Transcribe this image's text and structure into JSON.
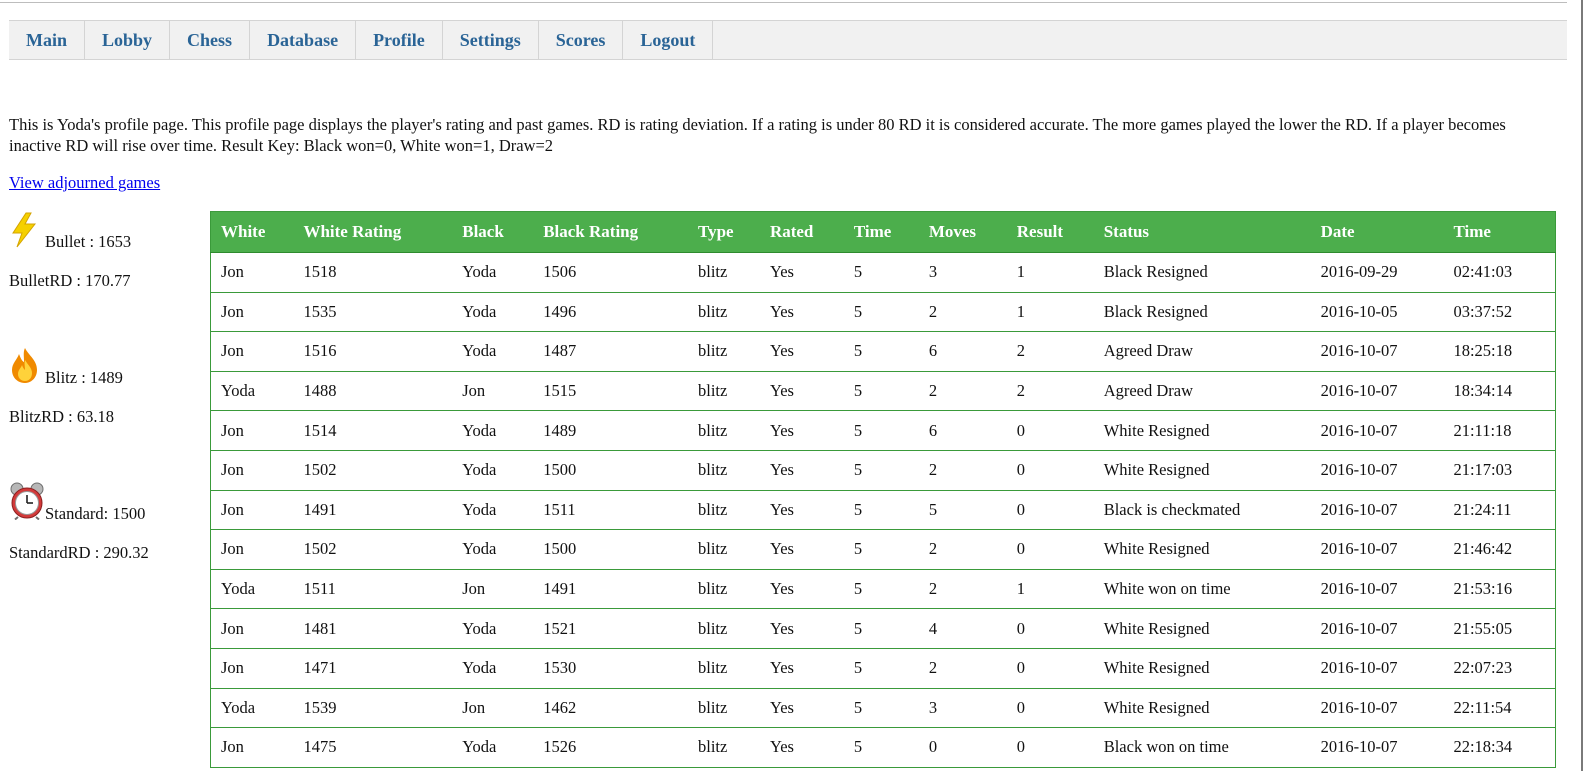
{
  "nav": {
    "items": [
      "Main",
      "Lobby",
      "Chess",
      "Database",
      "Profile",
      "Settings",
      "Scores",
      "Logout"
    ]
  },
  "intro": {
    "text": "This is Yoda's profile page. This profile page displays the player's rating and past games. RD is rating deviation. If a rating is under 80 RD it is considered accurate. The more games played the lower the RD. If a player becomes inactive RD will rise over time. Result Key: Black won=0, White won=1, Draw=2"
  },
  "adjourned_link": "View adjourned games",
  "ratings": {
    "bullet": {
      "label": "Bullet : 1653",
      "rd": "BulletRD : 170.77",
      "icon": "lightning-icon"
    },
    "blitz": {
      "label": "Blitz : 1489",
      "rd": "BlitzRD : 63.18",
      "icon": "fire-icon"
    },
    "standard": {
      "label": "Standard: 1500",
      "rd": "StandardRD : 290.32",
      "icon": "alarm-clock-icon"
    }
  },
  "table": {
    "headers": [
      "White",
      "White Rating",
      "Black",
      "Black Rating",
      "Type",
      "Rated",
      "Time",
      "Moves",
      "Result",
      "Status",
      "Date",
      "Time"
    ],
    "rows": [
      [
        "Jon",
        "1518",
        "Yoda",
        "1506",
        "blitz",
        "Yes",
        "5",
        "3",
        "1",
        "Black Resigned",
        "2016-09-29",
        "02:41:03"
      ],
      [
        "Jon",
        "1535",
        "Yoda",
        "1496",
        "blitz",
        "Yes",
        "5",
        "2",
        "1",
        "Black Resigned",
        "2016-10-05",
        "03:37:52"
      ],
      [
        "Jon",
        "1516",
        "Yoda",
        "1487",
        "blitz",
        "Yes",
        "5",
        "6",
        "2",
        "Agreed Draw",
        "2016-10-07",
        "18:25:18"
      ],
      [
        "Yoda",
        "1488",
        "Jon",
        "1515",
        "blitz",
        "Yes",
        "5",
        "2",
        "2",
        "Agreed Draw",
        "2016-10-07",
        "18:34:14"
      ],
      [
        "Jon",
        "1514",
        "Yoda",
        "1489",
        "blitz",
        "Yes",
        "5",
        "6",
        "0",
        "White Resigned",
        "2016-10-07",
        "21:11:18"
      ],
      [
        "Jon",
        "1502",
        "Yoda",
        "1500",
        "blitz",
        "Yes",
        "5",
        "2",
        "0",
        "White Resigned",
        "2016-10-07",
        "21:17:03"
      ],
      [
        "Jon",
        "1491",
        "Yoda",
        "1511",
        "blitz",
        "Yes",
        "5",
        "5",
        "0",
        "Black is checkmated",
        "2016-10-07",
        "21:24:11"
      ],
      [
        "Jon",
        "1502",
        "Yoda",
        "1500",
        "blitz",
        "Yes",
        "5",
        "2",
        "0",
        "White Resigned",
        "2016-10-07",
        "21:46:42"
      ],
      [
        "Yoda",
        "1511",
        "Jon",
        "1491",
        "blitz",
        "Yes",
        "5",
        "2",
        "1",
        "White won on time",
        "2016-10-07",
        "21:53:16"
      ],
      [
        "Jon",
        "1481",
        "Yoda",
        "1521",
        "blitz",
        "Yes",
        "5",
        "4",
        "0",
        "White Resigned",
        "2016-10-07",
        "21:55:05"
      ],
      [
        "Jon",
        "1471",
        "Yoda",
        "1530",
        "blitz",
        "Yes",
        "5",
        "2",
        "0",
        "White Resigned",
        "2016-10-07",
        "22:07:23"
      ],
      [
        "Yoda",
        "1539",
        "Jon",
        "1462",
        "blitz",
        "Yes",
        "5",
        "3",
        "0",
        "White Resigned",
        "2016-10-07",
        "22:11:54"
      ],
      [
        "Jon",
        "1475",
        "Yoda",
        "1526",
        "blitz",
        "Yes",
        "5",
        "0",
        "0",
        "Black won on time",
        "2016-10-07",
        "22:18:34"
      ]
    ]
  },
  "colors": {
    "nav_link": "#2a6496",
    "table_header_bg": "#4cae4c",
    "table_border": "#3a9a3a",
    "link": "#0000ee"
  }
}
